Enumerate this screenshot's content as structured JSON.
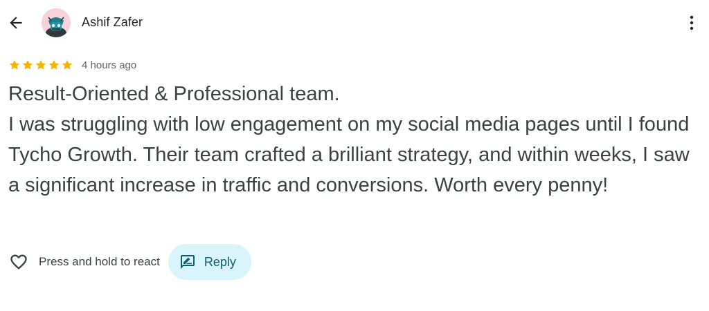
{
  "header": {
    "author_name": "Ashif Zafer",
    "avatar_icon": "avatar-image",
    "back_icon": "arrow-left-icon",
    "more_icon": "more-vertical-icon"
  },
  "review": {
    "rating": 5,
    "rating_max": 5,
    "star_color": "#f4b400",
    "time_ago": "4 hours ago",
    "title": "Result-Oriented & Professional team.",
    "text": "I was struggling with low engagement on my social media pages until I found Tycho Growth. Their team crafted a brilliant strategy, and within weeks, I saw a significant increase in traffic and conversions. Worth every penny!"
  },
  "actions": {
    "react_label": "Press and hold to react",
    "reply_label": "Reply",
    "reply_bg": "#d9f4fb",
    "reply_text_color": "#0b5e73"
  }
}
